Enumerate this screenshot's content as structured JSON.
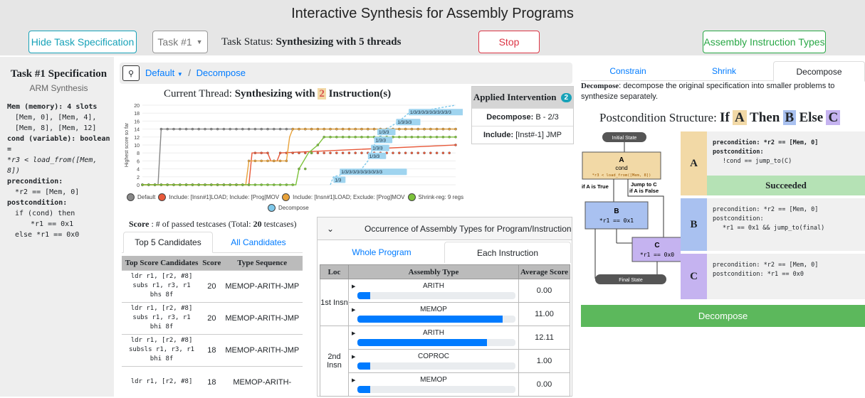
{
  "header": {
    "title": "Interactive Synthesis for Assembly Programs",
    "hide_spec_label": "Hide Task Specification",
    "task_select": "Task #1",
    "status_label": "Task Status:",
    "status_value": "Synthesizing with 5 threads",
    "stop_label": "Stop",
    "asm_types_label": "Assembly Instruction Types"
  },
  "spec": {
    "title": "Task #1 Specification",
    "subtitle": "ARM Synthesis",
    "lines": [
      "Mem (memory): 4 slots",
      "[Mem, 0], [Mem, 4],",
      "[Mem, 8], [Mem, 12]",
      "cond (variable): boolean =",
      "*r3 < load_from([Mem, 8])",
      "precondition:",
      "*r2 == [Mem, 0]",
      "postcondition:",
      "if (cond) then",
      "*r1 == 0x1",
      "else *r1 == 0x0"
    ]
  },
  "breadcrumb": {
    "first": "Default",
    "sep": "/",
    "current": "Decompose"
  },
  "chart_title": {
    "prefix": "Current Thread:",
    "pre_num": "Synthesizing with",
    "num": "2",
    "post_num": "Instruction(s)"
  },
  "chart_data": {
    "type": "line",
    "ylabel": "Highest score so far",
    "ylim": [
      0,
      20
    ],
    "yticks": [
      0,
      2,
      4,
      6,
      8,
      10,
      12,
      14,
      16,
      18,
      20
    ],
    "series": [
      {
        "name": "Default",
        "color": "#888888",
        "points": [
          [
            0,
            0
          ],
          [
            5,
            0
          ],
          [
            6,
            14
          ],
          [
            100,
            14
          ]
        ]
      },
      {
        "name": "Include: [Insn#1]LOAD; Include: [Prog]MOV",
        "color": "#e8593a",
        "points": [
          [
            0,
            0
          ],
          [
            34,
            0
          ],
          [
            35,
            8
          ],
          [
            40,
            8
          ],
          [
            41,
            6
          ],
          [
            43,
            6
          ],
          [
            44,
            8
          ],
          [
            100,
            10
          ]
        ]
      },
      {
        "name": "Include: [Insn#1]LOAD; Exclude: [Prog]MOV",
        "color": "#e8a23a",
        "points": [
          [
            0,
            0
          ],
          [
            33,
            0
          ],
          [
            34,
            6
          ],
          [
            46,
            6
          ],
          [
            47,
            12
          ],
          [
            48,
            14
          ],
          [
            100,
            14
          ]
        ]
      },
      {
        "name": "Shrink-reg: 9 regs",
        "color": "#7cc23a",
        "points": [
          [
            0,
            0
          ],
          [
            49,
            0
          ],
          [
            50,
            4
          ],
          [
            53,
            8
          ],
          [
            56,
            10
          ],
          [
            58,
            12
          ],
          [
            100,
            12
          ]
        ]
      },
      {
        "name": "Decompose",
        "color": "#7ec8ea",
        "points": [
          [
            60,
            0
          ],
          [
            61,
            2
          ],
          [
            70,
            4
          ],
          [
            72,
            6
          ],
          [
            74,
            10
          ],
          [
            76,
            12
          ],
          [
            78,
            14
          ],
          [
            82,
            16
          ],
          [
            85,
            18
          ],
          [
            100,
            20
          ]
        ]
      }
    ],
    "annotations": [
      "1/3",
      "1/3/3/3/3/3/3/3/3/3/3",
      "1/3/3",
      "1/3/3",
      "1/3/3",
      "1/3/3",
      "1/3/3/3",
      "1/3/3/3/3/3/3/3/3/3/3"
    ],
    "legend": [
      "Default",
      "Include: [Insn#1]LOAD; Include: [Prog]MOV",
      "Include: [Insn#1]LOAD; Exclude: [Prog]MOV",
      "Shrink-reg: 9 regs",
      "Decompose"
    ]
  },
  "intervention": {
    "title": "Applied Intervention",
    "count": "2",
    "row1_label": "Decompose:",
    "row1_value": "B - 2/3",
    "row2_label": "Include:",
    "row2_value": "[Inst#-1] JMP"
  },
  "score": {
    "label": "Score",
    "desc": ": # of passed testcases (Total:",
    "total": "20",
    "suffix": "testcases)"
  },
  "candidates": {
    "tab_top5": "Top 5 Candidates",
    "tab_all": "All Candidates",
    "headers": [
      "Top Score Candidates",
      "Score",
      "Type Sequence"
    ],
    "rows": [
      {
        "code": [
          "ldr r1, [r2, #8]",
          "subs r1, r3, r1",
          "bhs 8f"
        ],
        "score": "20",
        "types": "MEMOP-ARITH-JMP"
      },
      {
        "code": [
          "ldr r1, [r2, #8]",
          "subs r1, r3, r1",
          "bhi 8f"
        ],
        "score": "20",
        "types": "MEMOP-ARITH-JMP"
      },
      {
        "code": [
          "ldr r1, [r2, #8]",
          "subsls r1, r3, r1",
          "bhi 8f"
        ],
        "score": "18",
        "types": "MEMOP-ARITH-JMP"
      },
      {
        "code": [
          "ldr r1, [r2, #8]",
          "",
          ""
        ],
        "score": "18",
        "types": "MEMOP-ARITH-"
      }
    ]
  },
  "occurrence": {
    "title": "Occurrence of Assembly Types for Program/Instruction",
    "tab_whole": "Whole Program",
    "tab_each": "Each Instruction",
    "headers": [
      "Loc",
      "Assembly Type",
      "Average Score"
    ],
    "rows": [
      {
        "loc": "1st Insn",
        "type": "ARITH",
        "fill": 0.08,
        "avg": "0.00"
      },
      {
        "loc": "",
        "type": "MEMOP",
        "fill": 0.92,
        "avg": "11.00"
      },
      {
        "loc": "2nd Insn",
        "type": "ARITH",
        "fill": 0.82,
        "avg": "12.11"
      },
      {
        "loc": "",
        "type": "COPROC",
        "fill": 0.08,
        "avg": "1.00"
      },
      {
        "loc": "",
        "type": "MEMOP",
        "fill": 0.08,
        "avg": "0.00"
      }
    ]
  },
  "right": {
    "tab_constrain": "Constrain",
    "tab_shrink": "Shrink",
    "tab_decompose": "Decompose",
    "desc_bold": "Decompose",
    "desc_rest": ": decompose the original specification into smaller problems to synthesize separately.",
    "struct_label": "Postcondition Structure:",
    "kw_if": "If",
    "kw_then": "Then",
    "kw_else": "Else",
    "var_a": "A",
    "var_b": "B",
    "var_c": "C",
    "color_a": "#f2d9a6",
    "color_b": "#a9c1f0",
    "color_c": "#c5b3f0",
    "flow": {
      "initial": "Initial State",
      "a_title": "A",
      "a_cond": "cond",
      "a_expr": "*r3 < load_from([Mem, 8])",
      "if_true": "if A is True",
      "jump_c": "Jump to C",
      "if_false": "if A is False",
      "b_title": "B",
      "b_expr": "*r1 == 0x1",
      "c_title": "C",
      "c_expr": "*r1 == 0x0",
      "final": "Final State"
    },
    "cond_a": {
      "pre": "precondition: *r2 == [Mem, 0]",
      "post": "postcondition:",
      "post2": "!cond == jump_to(C)",
      "status": "Succeeded"
    },
    "cond_b": {
      "pre": "precondition: *r2 == [Mem, 0]",
      "post": "postcondition:",
      "post2": "*r1 == 0x1 && jump_to(final)"
    },
    "cond_c": {
      "pre": "precondition: *r2 == [Mem, 0]",
      "post": "postcondition: *r1 == 0x0"
    },
    "decompose_btn": "Decompose"
  }
}
